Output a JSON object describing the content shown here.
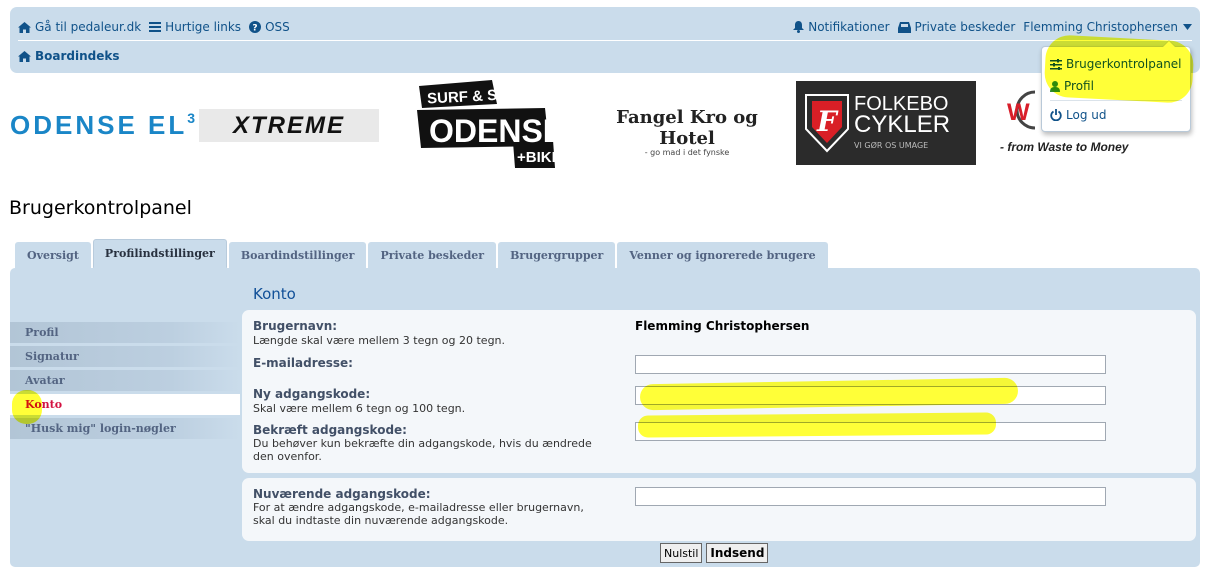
{
  "nav": {
    "home_link": "Gå til pedaleur.dk",
    "quick_links": "Hurtige links",
    "faq": "OSS",
    "notifications": "Notifikationer",
    "private_messages": "Private beskeder",
    "username": "Flemming Christophersen",
    "board_index": "Boardindeks"
  },
  "dropdown": {
    "items": [
      "Brugerkontrolpanel",
      "Profil",
      "Log ud"
    ]
  },
  "banner": {
    "odense_el": "ODENSE EL",
    "xtreme": "XTREME",
    "surf_line1": "SURF & SKI",
    "surf_line2": "ODENSE",
    "surf_line3": "+BIKE",
    "fangel_title": "Fangel Kro og Hotel",
    "fangel_sub": "- go mad i det fynske",
    "folkebo_line1": "FOLKEBO",
    "folkebo_line2": "CYKLER",
    "folkebo_sub": "VI GØR OS UMAGE",
    "waste": "- from Waste to Money"
  },
  "page": {
    "title": "Brugerkontrolpanel",
    "section_title": "Konto"
  },
  "tabs": [
    "Oversigt",
    "Profilindstillinger",
    "Boardindstillinger",
    "Private beskeder",
    "Brugergrupper",
    "Venner og ignorerede brugere"
  ],
  "sidebar": {
    "items": [
      "Profil",
      "Signatur",
      "Avatar",
      "Konto",
      "\"Husk mig\" login-nøgler"
    ]
  },
  "form": {
    "username_label": "Brugernavn:",
    "username_expl": "Længde skal være mellem 3 tegn og 20 tegn.",
    "username_value": "Flemming Christophersen",
    "email_label": "E-mailadresse:",
    "email_value": "",
    "newpass_label": "Ny adgangskode:",
    "newpass_expl": "Skal være mellem 6 tegn og 100 tegn.",
    "confirm_label": "Bekræft adgangskode:",
    "confirm_expl_1": "Du behøver kun bekræfte din adgangskode, hvis du ændrede",
    "confirm_expl_2": "den ovenfor.",
    "current_label": "Nuværende adgangskode:",
    "current_expl_1": "For at ændre adgangskode, e-mailadresse eller brugernavn,",
    "current_expl_2": "skal du indtaste din nuværende adgangskode.",
    "reset_button": "Nulstil",
    "submit_button": "Indsend"
  },
  "colors": {
    "header_bg": "#cadceb",
    "link": "#105289",
    "active_menu": "#d31141",
    "highlight": "#ffff00"
  }
}
